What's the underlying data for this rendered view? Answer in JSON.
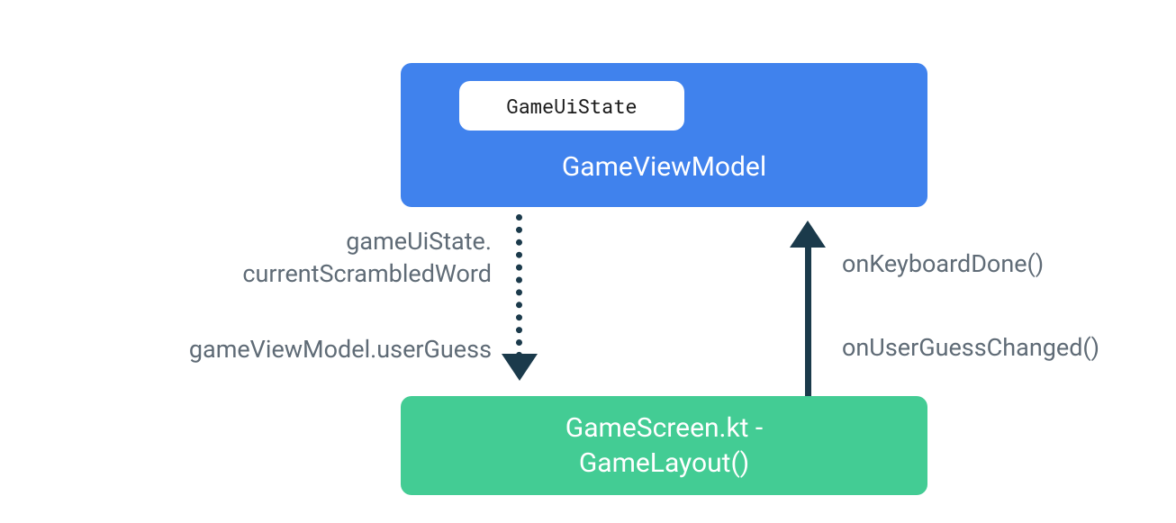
{
  "viewmodel": {
    "title": "GameViewModel",
    "uistate_label": "GameUiState"
  },
  "screen": {
    "line1": "GameScreen.kt -",
    "line2": "GameLayout()"
  },
  "labels": {
    "down1_line1": "gameUiState.",
    "down1_line2": "currentScrambledWord",
    "down2": "gameViewModel.userGuess",
    "up1": "onKeyboardDone()",
    "up2": "onUserGuessChanged()"
  }
}
